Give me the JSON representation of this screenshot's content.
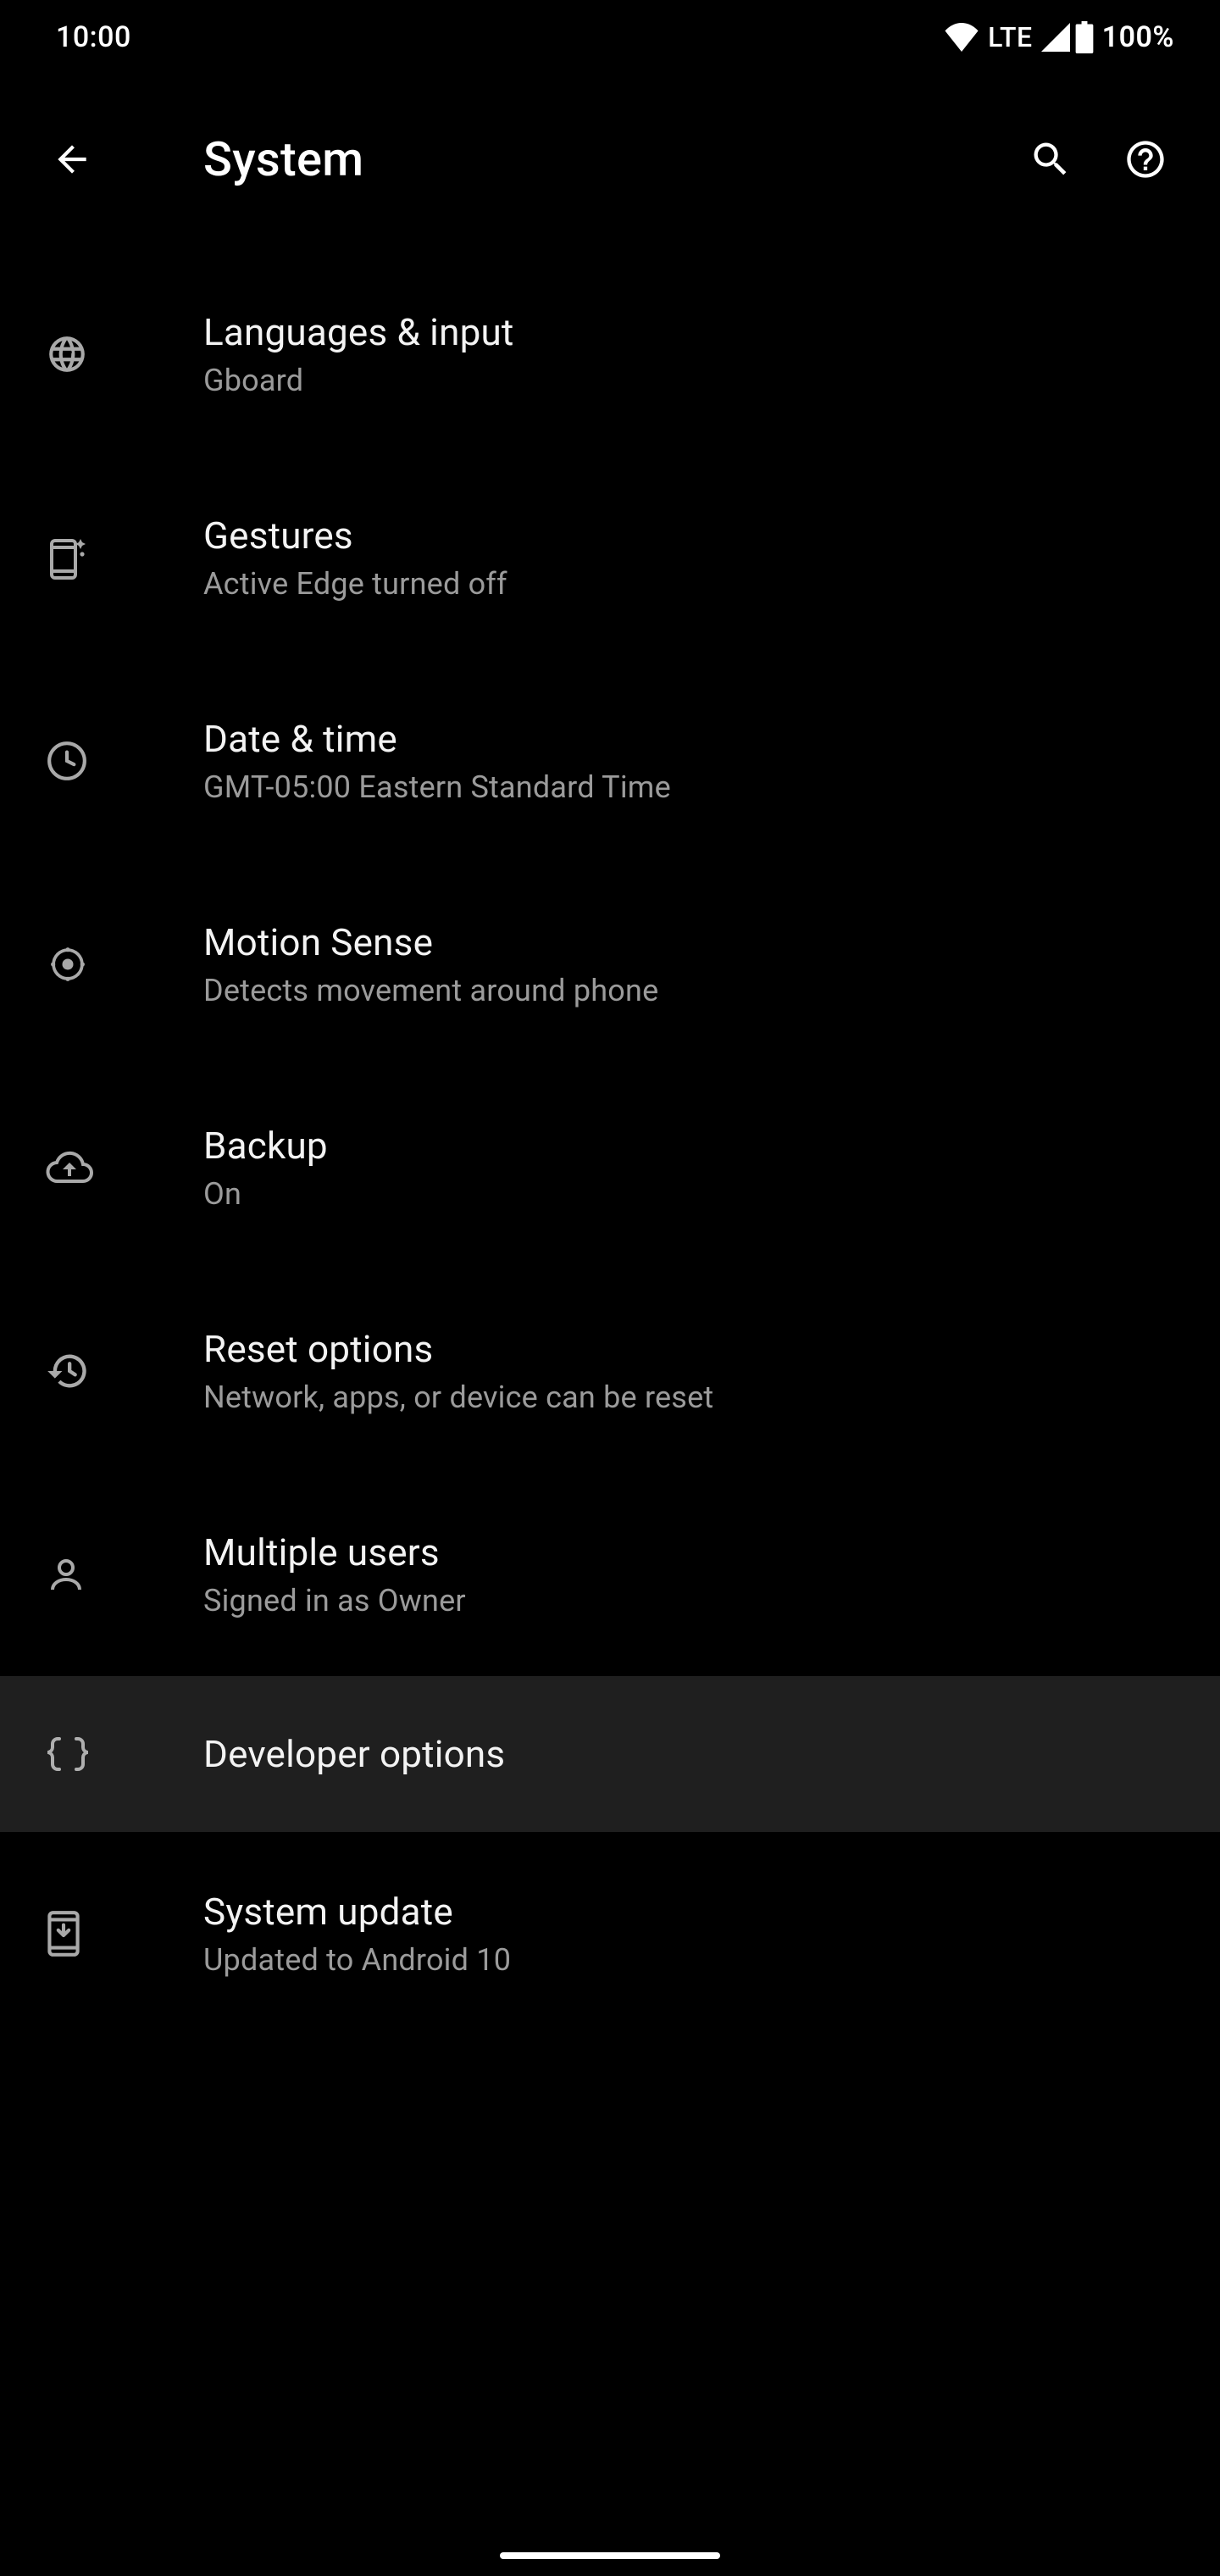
{
  "status": {
    "time": "10:00",
    "lte": "LTE",
    "battery_pct": "100%"
  },
  "header": {
    "title": "System"
  },
  "items": [
    {
      "title": "Languages & input",
      "sub": "Gboard",
      "icon": "globe"
    },
    {
      "title": "Gestures",
      "sub": "Active Edge turned off",
      "icon": "phone-sparkle"
    },
    {
      "title": "Date & time",
      "sub": "GMT-05:00 Eastern Standard Time",
      "icon": "clock"
    },
    {
      "title": "Motion Sense",
      "sub": "Detects movement around phone",
      "icon": "motion"
    },
    {
      "title": "Backup",
      "sub": "On",
      "icon": "cloud-up"
    },
    {
      "title": "Reset options",
      "sub": "Network, apps, or device can be reset",
      "icon": "history"
    },
    {
      "title": "Multiple users",
      "sub": "Signed in as Owner",
      "icon": "person"
    },
    {
      "title": "Developer options",
      "sub": "",
      "icon": "braces"
    },
    {
      "title": "System update",
      "sub": "Updated to Android 10",
      "icon": "phone-down"
    }
  ]
}
